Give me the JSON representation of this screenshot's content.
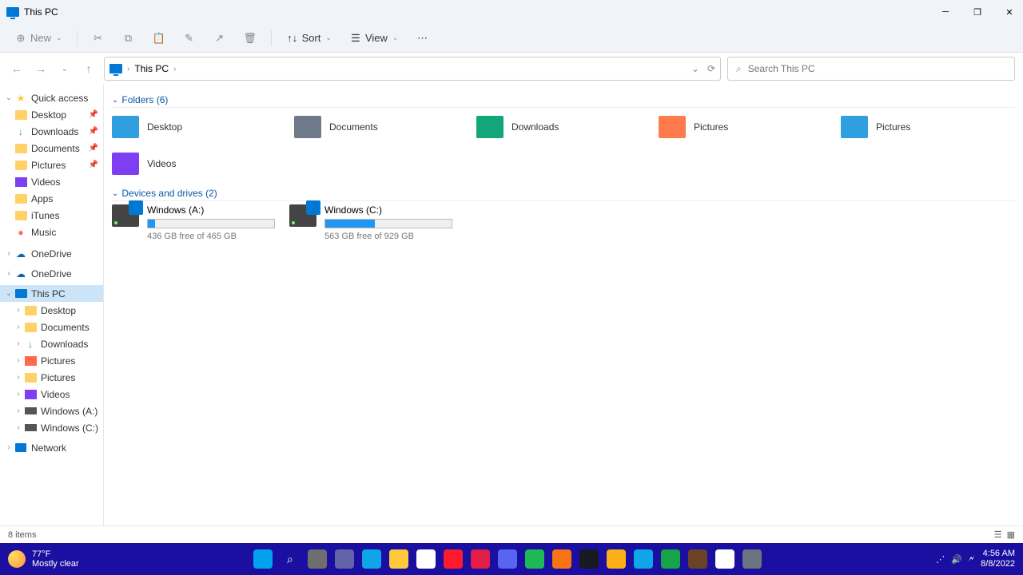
{
  "window": {
    "title": "This PC"
  },
  "toolbar": {
    "new": "New",
    "sort": "Sort",
    "view": "View"
  },
  "address": {
    "crumbs": [
      "This PC"
    ],
    "search_placeholder": "Search This PC"
  },
  "sidebar": {
    "quick": {
      "label": "Quick access",
      "items": [
        {
          "label": "Desktop",
          "pin": true,
          "type": "folder"
        },
        {
          "label": "Downloads",
          "pin": true,
          "type": "dl"
        },
        {
          "label": "Documents",
          "pin": true,
          "type": "folder"
        },
        {
          "label": "Pictures",
          "pin": true,
          "type": "folder"
        },
        {
          "label": "Videos",
          "pin": false,
          "type": "vid"
        },
        {
          "label": "Apps",
          "pin": false,
          "type": "folder"
        },
        {
          "label": "iTunes",
          "pin": false,
          "type": "folder"
        },
        {
          "label": "Music",
          "pin": false,
          "type": "music"
        }
      ]
    },
    "onedrive1": "OneDrive",
    "onedrive2": "OneDrive",
    "thispc": {
      "label": "This PC",
      "items": [
        {
          "label": "Desktop",
          "type": "folder"
        },
        {
          "label": "Documents",
          "type": "folder"
        },
        {
          "label": "Downloads",
          "type": "dl"
        },
        {
          "label": "Pictures",
          "type": "pics"
        },
        {
          "label": "Pictures",
          "type": "folder"
        },
        {
          "label": "Videos",
          "type": "vid"
        },
        {
          "label": "Windows (A:)",
          "type": "drive"
        },
        {
          "label": "Windows (C:)",
          "type": "drive"
        }
      ]
    },
    "network": "Network"
  },
  "groups": {
    "folders": {
      "title": "Folders (6)",
      "items": [
        {
          "label": "Desktop",
          "color": "#2f9fe0"
        },
        {
          "label": "Documents",
          "color": "#6e7a8a"
        },
        {
          "label": "Downloads",
          "color": "#12a67a"
        },
        {
          "label": "Pictures",
          "color": "#ff7a4d"
        },
        {
          "label": "Pictures",
          "color": "#2f9fe0"
        },
        {
          "label": "Videos",
          "color": "#7e3ff2"
        }
      ]
    },
    "drives": {
      "title": "Devices and drives (2)",
      "items": [
        {
          "name": "Windows (A:)",
          "free": "436 GB free of 465 GB",
          "pct": 6
        },
        {
          "name": "Windows (C:)",
          "free": "563 GB free of 929 GB",
          "pct": 39
        }
      ]
    }
  },
  "status": {
    "items": "8 items"
  },
  "taskbar": {
    "weather_temp": "77°F",
    "weather_cond": "Mostly clear",
    "time": "4:56 AM",
    "date": "8/8/2022",
    "apps": [
      {
        "name": "start",
        "bg": "#00a2ed"
      },
      {
        "name": "search",
        "bg": "transparent"
      },
      {
        "name": "taskview",
        "bg": "#6e6e6e"
      },
      {
        "name": "chat",
        "bg": "#6264a7"
      },
      {
        "name": "edge",
        "bg": "#0ea5e9"
      },
      {
        "name": "file_explorer",
        "bg": "#ffc83d"
      },
      {
        "name": "store",
        "bg": "#fff"
      },
      {
        "name": "opera_gx",
        "bg": "#ff1b2d"
      },
      {
        "name": "app_red",
        "bg": "#e11d48"
      },
      {
        "name": "discord",
        "bg": "#5865f2"
      },
      {
        "name": "spotify",
        "bg": "#1db954"
      },
      {
        "name": "app_orange",
        "bg": "#f97316"
      },
      {
        "name": "steam",
        "bg": "#171a21"
      },
      {
        "name": "rockstar",
        "bg": "#fcaf17"
      },
      {
        "name": "app_blue",
        "bg": "#0ea5e9"
      },
      {
        "name": "app_green",
        "bg": "#16a34a"
      },
      {
        "name": "minecraft",
        "bg": "#6b4226"
      },
      {
        "name": "roblox",
        "bg": "#ffffff"
      },
      {
        "name": "settings",
        "bg": "#6b7280"
      }
    ]
  }
}
